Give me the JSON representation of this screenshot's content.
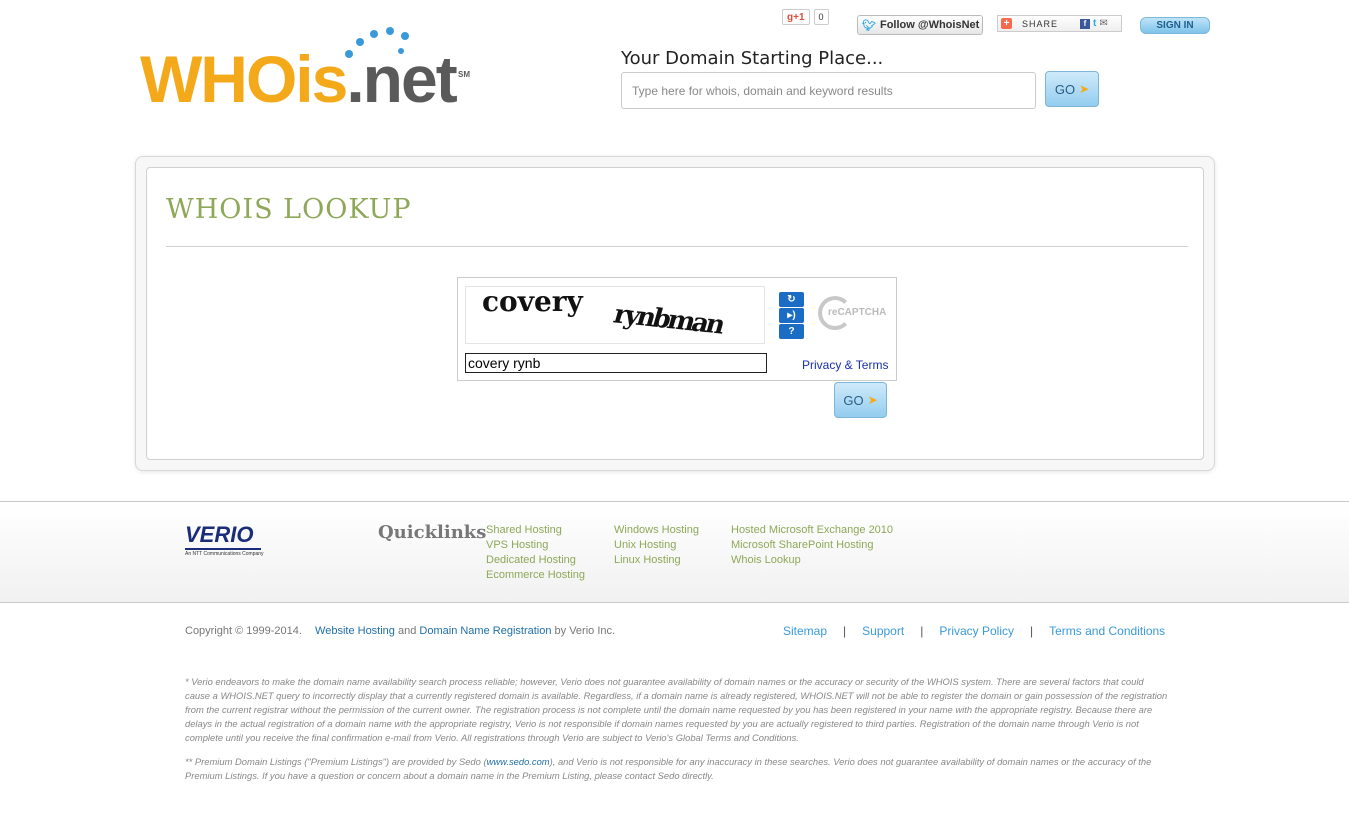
{
  "header": {
    "logo": {
      "who": "WHOis",
      "net": ".net",
      "sm": "SM"
    },
    "gplus": {
      "label": "+1",
      "count": "0"
    },
    "twitter_follow": "Follow @WhoisNet",
    "share_label": "SHARE",
    "sign_in": "SIGN IN",
    "tagline": "Your Domain Starting Place...",
    "search_placeholder": "Type here for whois, domain and keyword results",
    "go_label": "GO"
  },
  "main": {
    "title": "WHOIS LOOKUP",
    "captcha": {
      "word1": "covery",
      "word2": "rynbman",
      "input_value": "covery rynb",
      "privacy_terms": "Privacy & Terms",
      "recaptcha_label": "reCAPTCHA",
      "reload_icon": "reload-icon",
      "audio_icon": "audio-icon",
      "help_icon": "help-icon"
    },
    "go_label": "GO"
  },
  "footer": {
    "verio": {
      "name": "VERIO",
      "sub": "An NTT Communications Company"
    },
    "quicklinks_title": "Quicklinks",
    "quicklinks": [
      [
        "Shared Hosting",
        "VPS Hosting",
        "Dedicated Hosting",
        "Ecommerce Hosting"
      ],
      [
        "Windows Hosting",
        "Unix Hosting",
        "Linux Hosting"
      ],
      [
        "Hosted Microsoft Exchange 2010",
        "Microsoft SharePoint Hosting",
        "Whois Lookup"
      ]
    ],
    "copyright": {
      "text": "Copyright © 1999-2014.",
      "link1": "Website Hosting",
      "and": "and",
      "link2": "Domain Name Registration",
      "by": "by Verio Inc."
    },
    "bottom_links": [
      "Sitemap",
      "Support",
      "Privacy Policy",
      "Terms and Conditions"
    ],
    "bottom_sep": "|",
    "disclaimer1": "* Verio endeavors to make the domain name availability search process reliable; however, Verio does not guarantee availability of domain names or the accuracy or security of the WHOIS system. There are several factors that could cause a WHOIS.NET query to incorrectly display that a currently registered domain is available. Regardless, if a domain name is already registered, WHOIS.NET will not be able to register the domain or gain possession of the registration from the current registrar without the permission of the current owner. The registration process is not complete until the domain name requested by you has been registered in your name with the appropriate registry. Because there are delays in the actual registration of a domain name with the appropriate registry, Verio is not responsible if domain names requested by you are actually registered to third parties. Registration of the domain name through Verio is not complete until you receive the final confirmation e-mail from Verio. All registrations through Verio are subject to Verio's Global Terms and Conditions.",
    "disclaimer2_pre": "** Premium Domain Listings (\"Premium Listings\") are provided by Sedo (",
    "disclaimer2_link": "www.sedo.com",
    "disclaimer2_post": "), and Verio is not responsible for any inaccuracy in these searches. Verio does not guarantee availability of domain names or the accuracy of the Premium Listings. If you have a question or concern about a domain name in the Premium Listing, please contact Sedo directly."
  }
}
